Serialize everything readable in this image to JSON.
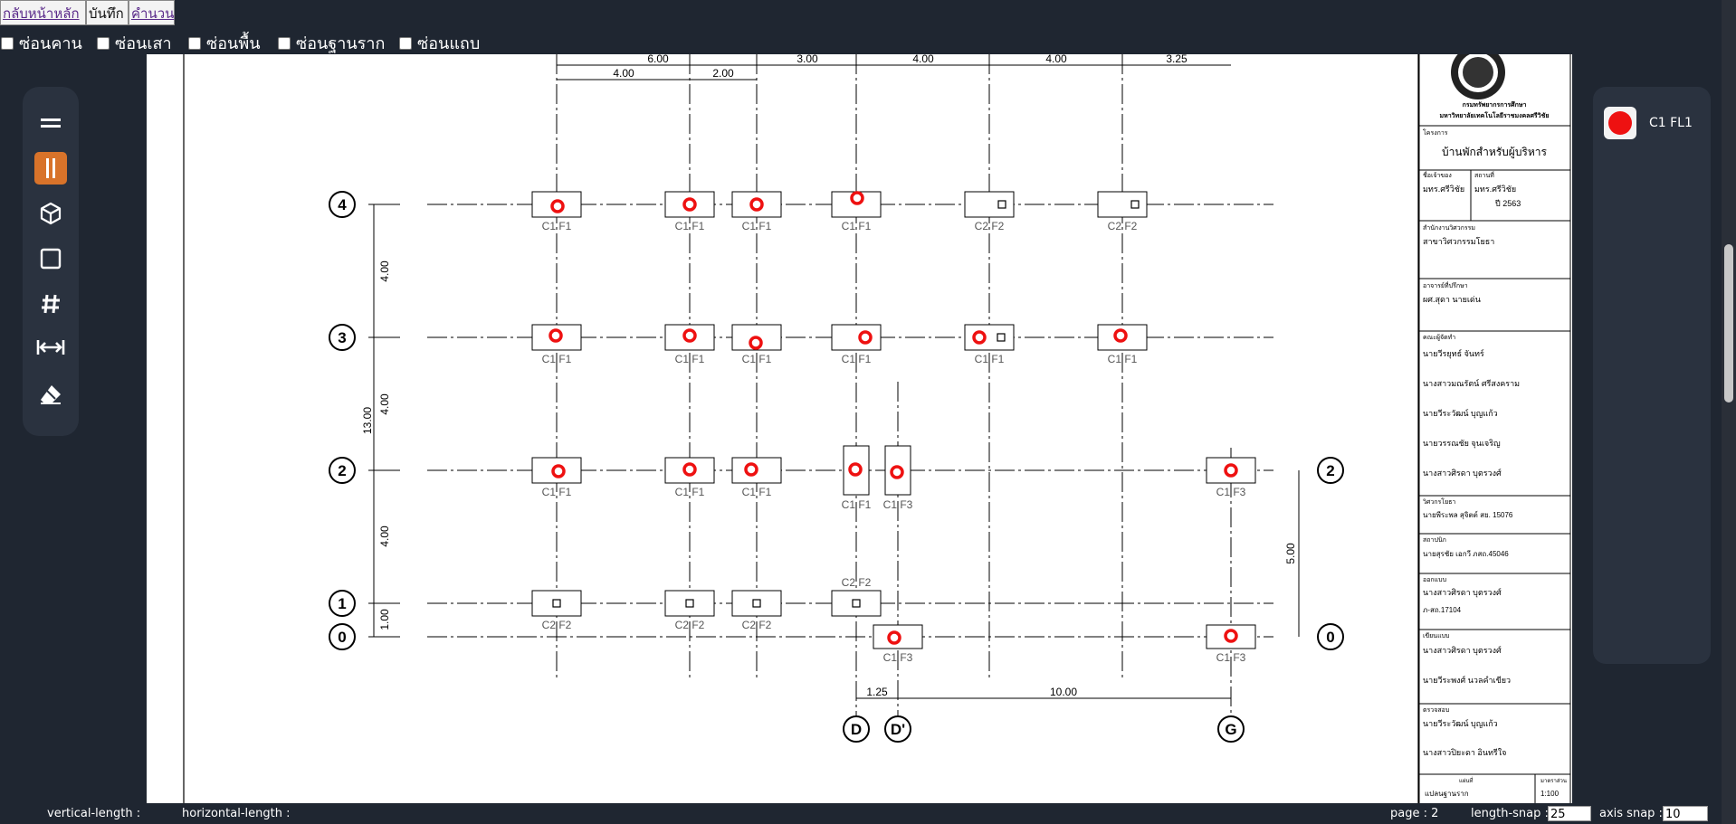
{
  "nav": {
    "home_label": "กลับหน้าหลัก",
    "save_label": "บันทึก",
    "calc_label": "คำนวน"
  },
  "hide_options": {
    "beams": "ซ่อนคาน",
    "columns": "ซ่อนเสา",
    "slabs": "ซ่อนพื้น",
    "footings": "ซ่อนฐานราก",
    "strips": "ซ่อนแถบ"
  },
  "toolbar": {
    "tools": [
      "beam-tool",
      "column-tool",
      "box-tool",
      "slab-tool",
      "grid-tool",
      "dimension-tool",
      "eraser-tool"
    ],
    "active_tool": "column-tool",
    "accent_color": "#d8732a"
  },
  "legend": {
    "label": "C1 FL1",
    "color": "#ee1111"
  },
  "drawing": {
    "top_dims_row1": [
      "6.00",
      "3.00",
      "4.00",
      "4.00",
      "3.25"
    ],
    "top_dims_row2": [
      "4.00",
      "2.00"
    ],
    "bottom_dims": [
      "1.25",
      "10.00"
    ],
    "left_dims": [
      "4.00",
      "4.00",
      "13.00",
      "4.00",
      "1.00"
    ],
    "right_dim": "5.00",
    "grid_labels_left": [
      "4",
      "3",
      "2",
      "1",
      "0"
    ],
    "grid_labels_right": [
      "2",
      "0"
    ],
    "grid_labels_bottom": [
      "D",
      "D'",
      "G"
    ],
    "footing_tags": {
      "row4": [
        "C1 F1",
        "C1 F1",
        "C1 F1",
        "C1 F1",
        "C2 F2",
        "C2 F2"
      ],
      "row3": [
        "C1 F1",
        "C1 F1",
        "C1 F1",
        "C1 F1",
        "C1 F1",
        "C1 F1"
      ],
      "row2": [
        "C1 F1",
        "C1 F1",
        "C1 F1",
        "C1 F1",
        "C1 F3",
        "C1 F3"
      ],
      "row1": [
        "C2 F2",
        "C2 F2",
        "C2 F2",
        "C2 F2"
      ],
      "row0": [
        "C1 F3",
        "C1 F3"
      ]
    }
  },
  "title_block": {
    "org_line1": "กรมทรัพยากรการศึกษา",
    "org_line2": "มหาวิทยาลัยเทคโนโลยีราชมงคลศรีวิชัย",
    "project_heading": "โครงการ",
    "project_name": "บ้านพักสำหรับผู้บริหาร",
    "owner_heading": "ชื่อเจ้าของ",
    "owner_value": "มทร.ศรีวิชัย",
    "location_heading": "สถานที่",
    "location_value": "มทร.ศรีวิชัย",
    "year_value": "ปี 2563",
    "firm_heading": "สำนักงานวิศวกรรม",
    "firm_value": "สาขาวิศวกรรมโยธา",
    "supervisor_heading": "อาจารย์ที่ปรึกษา",
    "supervisor_value": "ผศ.สุดา นายเด่น",
    "team_heading": "คณะผู้จัดทำ",
    "team_members": [
      "นายวีรยุทธ์ จันทร์",
      "นางสาวมณรัตน์ ศรีสงคราม",
      "นายวีระวัฒน์ บุญแก้ว",
      "นายวรรณชัย จุนเจริญ",
      "นางสาวศิรดา บุตรวงศ์"
    ],
    "engineer_heading": "วิศวกรโยธา",
    "engineer_value": "นายพีระพล สุจิตต์ สย. 15076",
    "architect_heading": "สถาปนิก",
    "architect_value": "นายสุรชัย เอกวี ภสถ.45046",
    "designer_heading": "ออกแบบ",
    "designer_value": "นางสาวศิรดา บุตรวงศ์",
    "designer_id": "ภ-สถ.17104",
    "drafter_heading": "เขียนแบบ",
    "drafter_values": [
      "นางสาวศิรดา บุตรวงศ์",
      "นายวีระพงศ์ นวลคำเขียว"
    ],
    "checker_heading": "ตรวจสอบ",
    "checker_values": [
      "นายวีระวัฒน์ บุญแก้ว",
      "นางสาวปิยะดา อินทรีใจ"
    ],
    "sheet_heading": "แผ่นที่",
    "scale_heading": "มาตราส่วน",
    "sheet_value": "แปลนฐานราก",
    "scale_value": "1:100"
  },
  "status": {
    "vertical_length_label": "vertical-length :",
    "horizontal_length_label": "horizontal-length :",
    "page_label": "page : 2",
    "length_snap_label": "length-snap :",
    "length_snap_value": "25",
    "axis_snap_label": "axis snap :",
    "axis_snap_value": "10"
  }
}
